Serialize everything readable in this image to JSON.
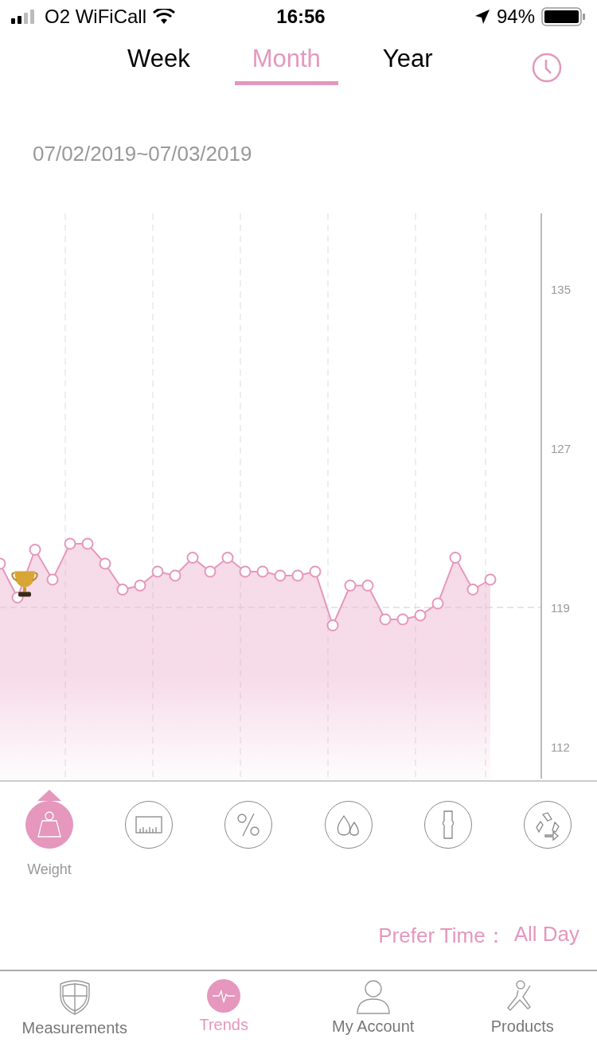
{
  "status_bar": {
    "carrier": "O2 WiFiCall",
    "time": "16:56",
    "battery": "94%"
  },
  "tabs": [
    {
      "label": "Week",
      "selected": false
    },
    {
      "label": "Month",
      "selected": true
    },
    {
      "label": "Year",
      "selected": false
    }
  ],
  "date_range": "07/02/2019~07/03/2019",
  "chart": {
    "chart_data": {
      "type": "area",
      "series": [
        {
          "color": "#e597bd",
          "values": [
            121.2,
            119.5,
            121.9,
            120.4,
            122.2,
            122.2,
            121.2,
            119.9,
            120.1,
            120.8,
            120.6,
            121.5,
            120.8,
            121.5,
            120.8,
            120.8,
            120.6,
            120.6,
            120.8,
            118.1,
            120.1,
            120.1,
            118.4,
            118.4,
            118.6,
            119.2,
            121.5,
            119.9,
            120.4
          ]
        }
      ],
      "ylim": [
        110.4,
        138.8
      ],
      "yticks": [
        112,
        119,
        127,
        135
      ]
    }
  },
  "metrics": [
    {
      "kind": "weight",
      "label": "Weight",
      "selected": true
    },
    {
      "kind": "bars",
      "selected": false
    },
    {
      "kind": "percent",
      "selected": false
    },
    {
      "kind": "drops",
      "selected": false
    },
    {
      "kind": "bone",
      "selected": false
    },
    {
      "kind": "recycle",
      "selected": false
    }
  ],
  "prefer_time": {
    "label": "Prefer Time：",
    "value": "All Day"
  },
  "nav": [
    {
      "kind": "shield",
      "label": "Measurements",
      "selected": false
    },
    {
      "kind": "pulse",
      "label": "Trends",
      "selected": true
    },
    {
      "kind": "person",
      "label": "My Account",
      "selected": false
    },
    {
      "kind": "figure",
      "label": "Products",
      "selected": false
    }
  ]
}
